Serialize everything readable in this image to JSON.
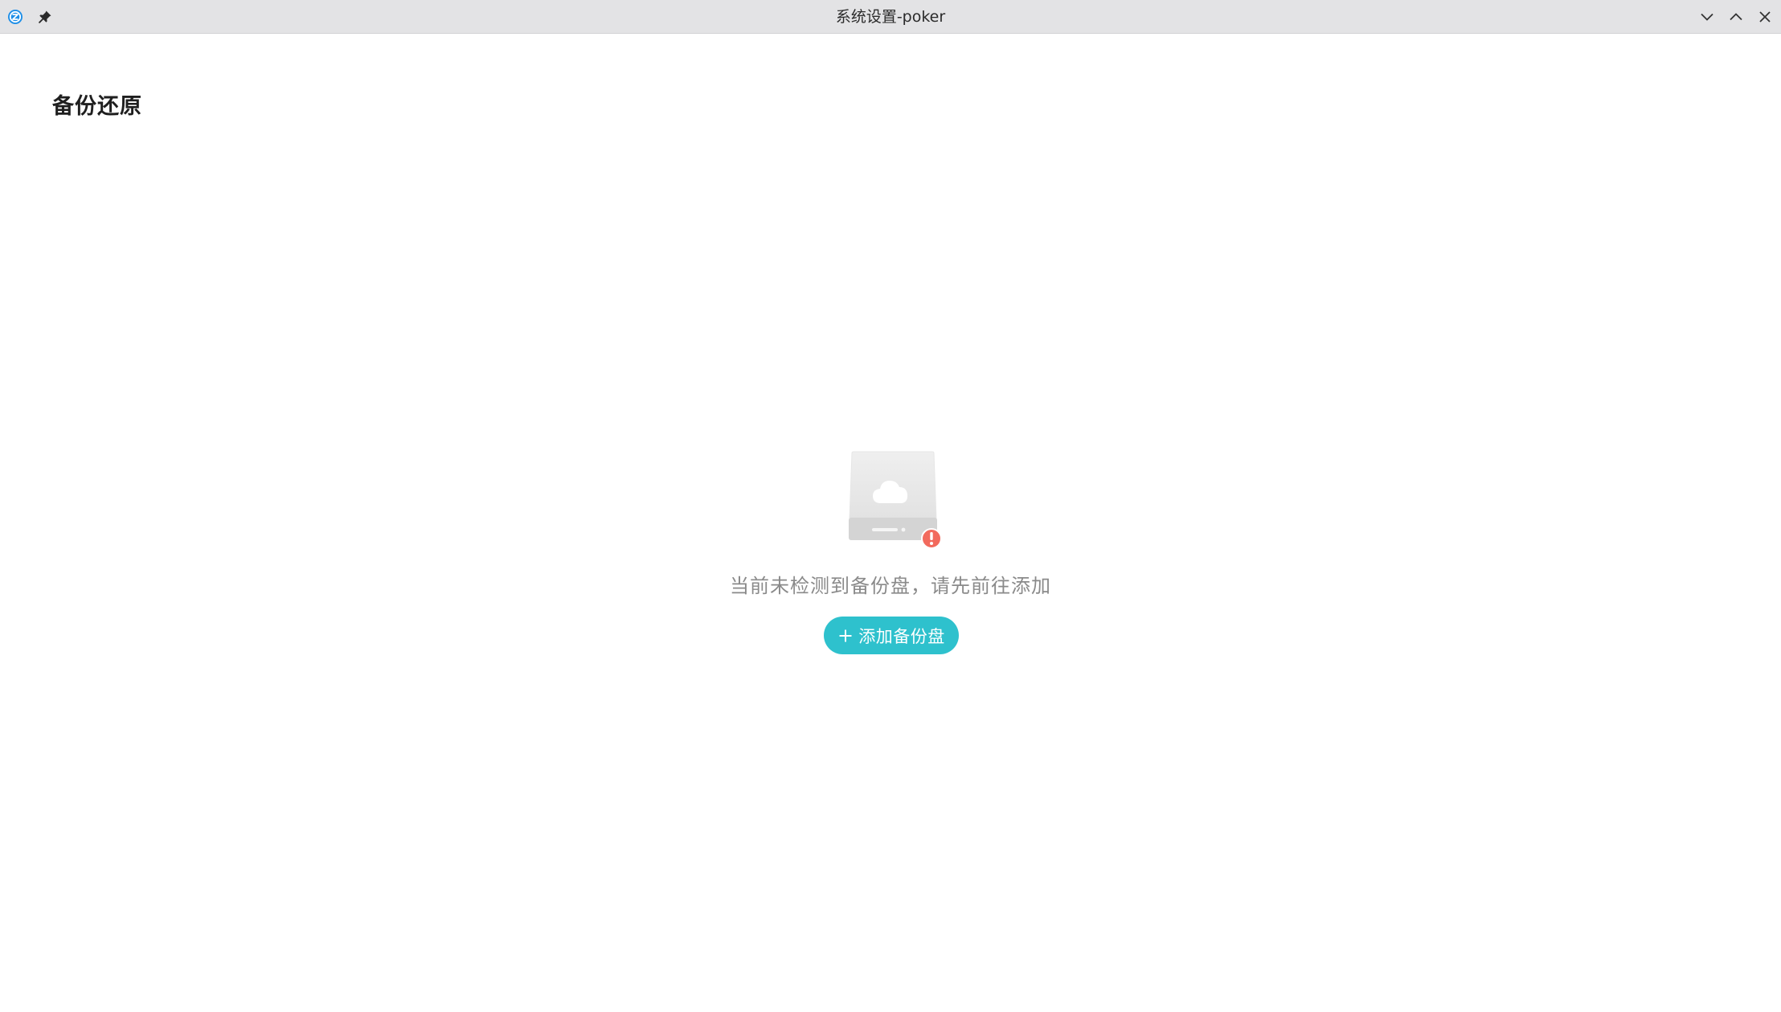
{
  "window": {
    "title": "系统设置-poker",
    "icons": {
      "app": "app-logo-icon",
      "pin": "pin-icon",
      "minimize": "chevron-down-icon",
      "maximize": "chevron-up-icon",
      "close": "close-icon"
    }
  },
  "page": {
    "title": "备份还原"
  },
  "empty_state": {
    "icon": "backup-disk-missing-icon",
    "message": "当前未检测到备份盘，请先前往添加",
    "button_label": "添加备份盘",
    "button_icon": "plus-icon"
  },
  "colors": {
    "accent": "#2ec1cd",
    "warning": "#f26a5d",
    "titlebar": "#e3e3e5",
    "message_text": "#8a8a8a"
  }
}
